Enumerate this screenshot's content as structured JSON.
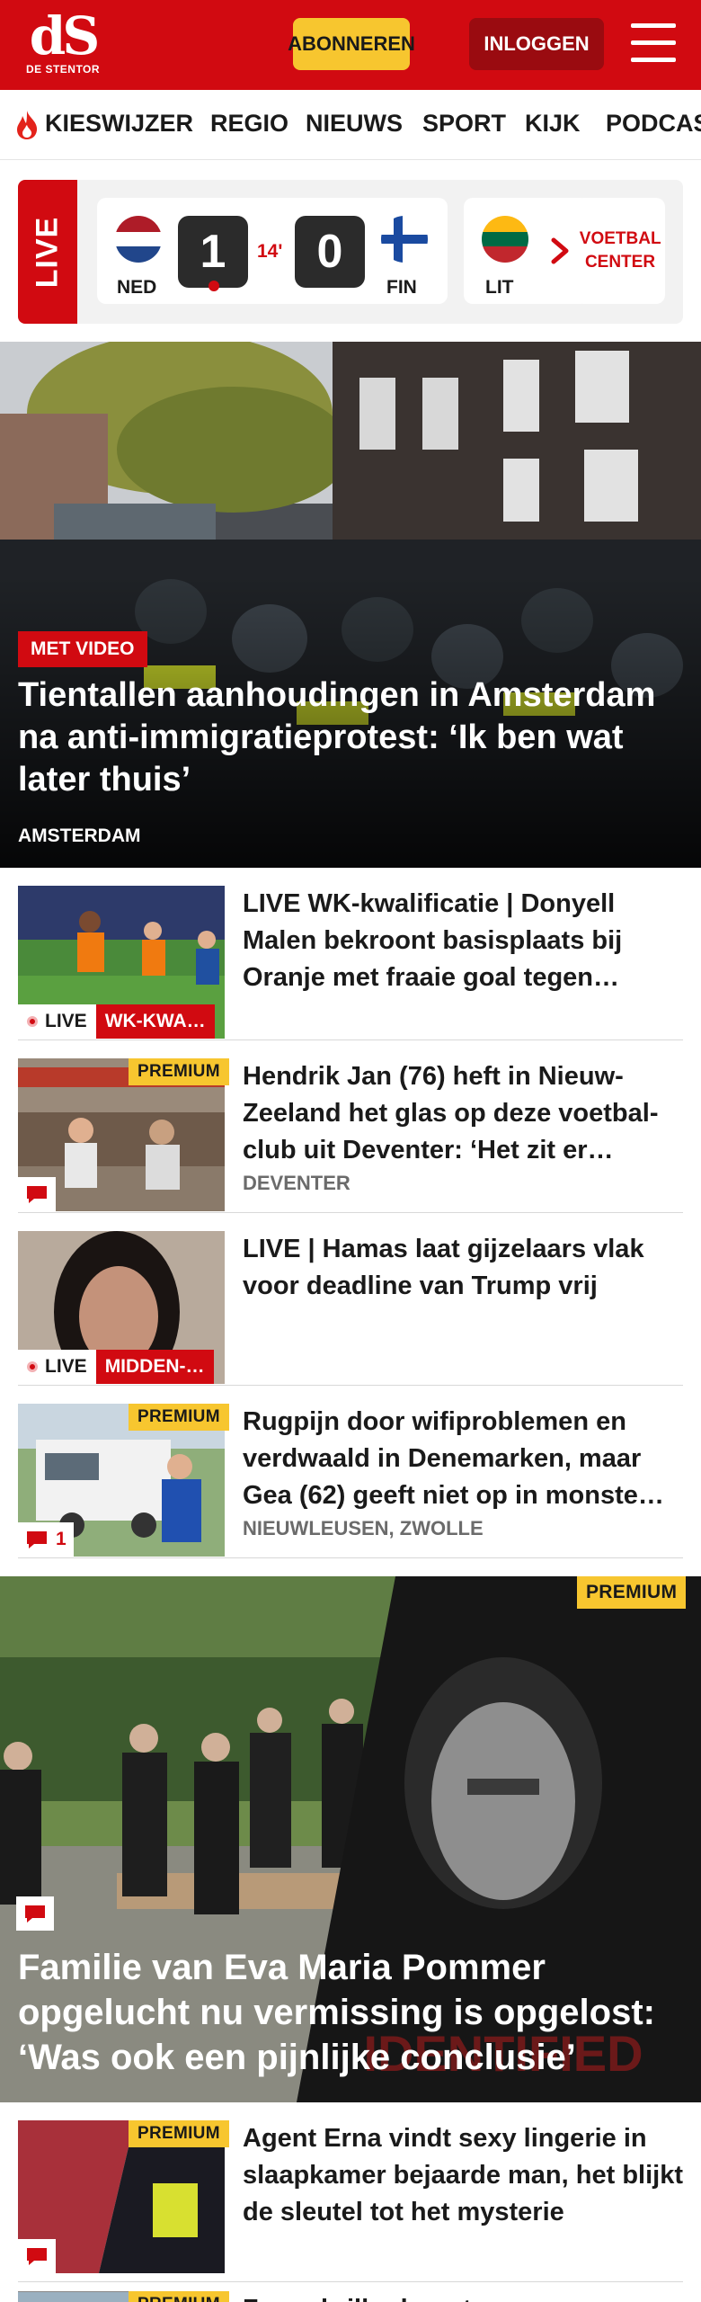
{
  "header": {
    "logo_mark": "dS",
    "logo_sub": "DE STENTOR",
    "subscribe_label": "ABONNEREN",
    "login_label": "INLOGGEN",
    "menu_icon": "hamburger-icon",
    "colors": {
      "brand": "#d10a11",
      "subscribe": "#f7c62f",
      "login": "#9a0b10"
    }
  },
  "nav": {
    "items": [
      {
        "label": "KIESWIJZER",
        "icon": "flame-icon"
      },
      {
        "label": "REGIO"
      },
      {
        "label": "NIEUWS"
      },
      {
        "label": "SPORT"
      },
      {
        "label": "KIJK"
      },
      {
        "label": "PODCAST"
      }
    ]
  },
  "live": {
    "tag": "LIVE",
    "match": {
      "home": "NED",
      "home_score": "1",
      "minute": "14'",
      "away_score": "0",
      "away": "FIN"
    },
    "next_team": "LIT",
    "voetbal_center": "VOETBAL CENTER"
  },
  "hero": {
    "badge": "MET VIDEO",
    "title": "Tientallen aanhoudingen in Amsterdam na anti-immigratiepro­test: ‘Ik ben wat later thuis’",
    "location": "AMSTERDAM"
  },
  "articles": [
    {
      "title": "LIVE WK-kwalificatie | Donyell Malen bekroont basisplaats bij Oranje met fraaie goal tegen…",
      "live_label": "LIVE",
      "category": "WK-KWA…"
    },
    {
      "premium": "PREMIUM",
      "title": "Hendrik Jan (76) heft in Nieuw-Zeeland het glas op deze voetbal­club uit Deventer: ‘Het zit er…",
      "location": "DEVENTER"
    },
    {
      "title": "LIVE | Hamas laat gijzelaars vlak voor deadline van Trump vrij",
      "live_label": "LIVE",
      "category": "MIDDEN-…"
    },
    {
      "premium": "PREMIUM",
      "title": "Rugpijn door wifiproblemen en verdwaald in Denemarken, maar Gea (62) geeft niet op in monste…",
      "location": "NIEUWLEUSEN, ZWOLLE",
      "comments": "1"
    }
  ],
  "feature": {
    "premium": "PREMIUM",
    "title": "Familie van Eva Maria Pommer opgelucht nu vermissing is opgelost: ‘Was ook een pijnlijke conclusie’",
    "stamp_text": "IDENTIFIED"
  },
  "article_after": {
    "premium": "PREMIUM",
    "title": "Agent Erna vindt sexy lingerie in slaapkamer bejaarde man, het blijkt de sleutel tot het mysterie"
  },
  "article_cut": {
    "premium": "PREMIUM",
    "title": "Zonnebriller koopt"
  }
}
